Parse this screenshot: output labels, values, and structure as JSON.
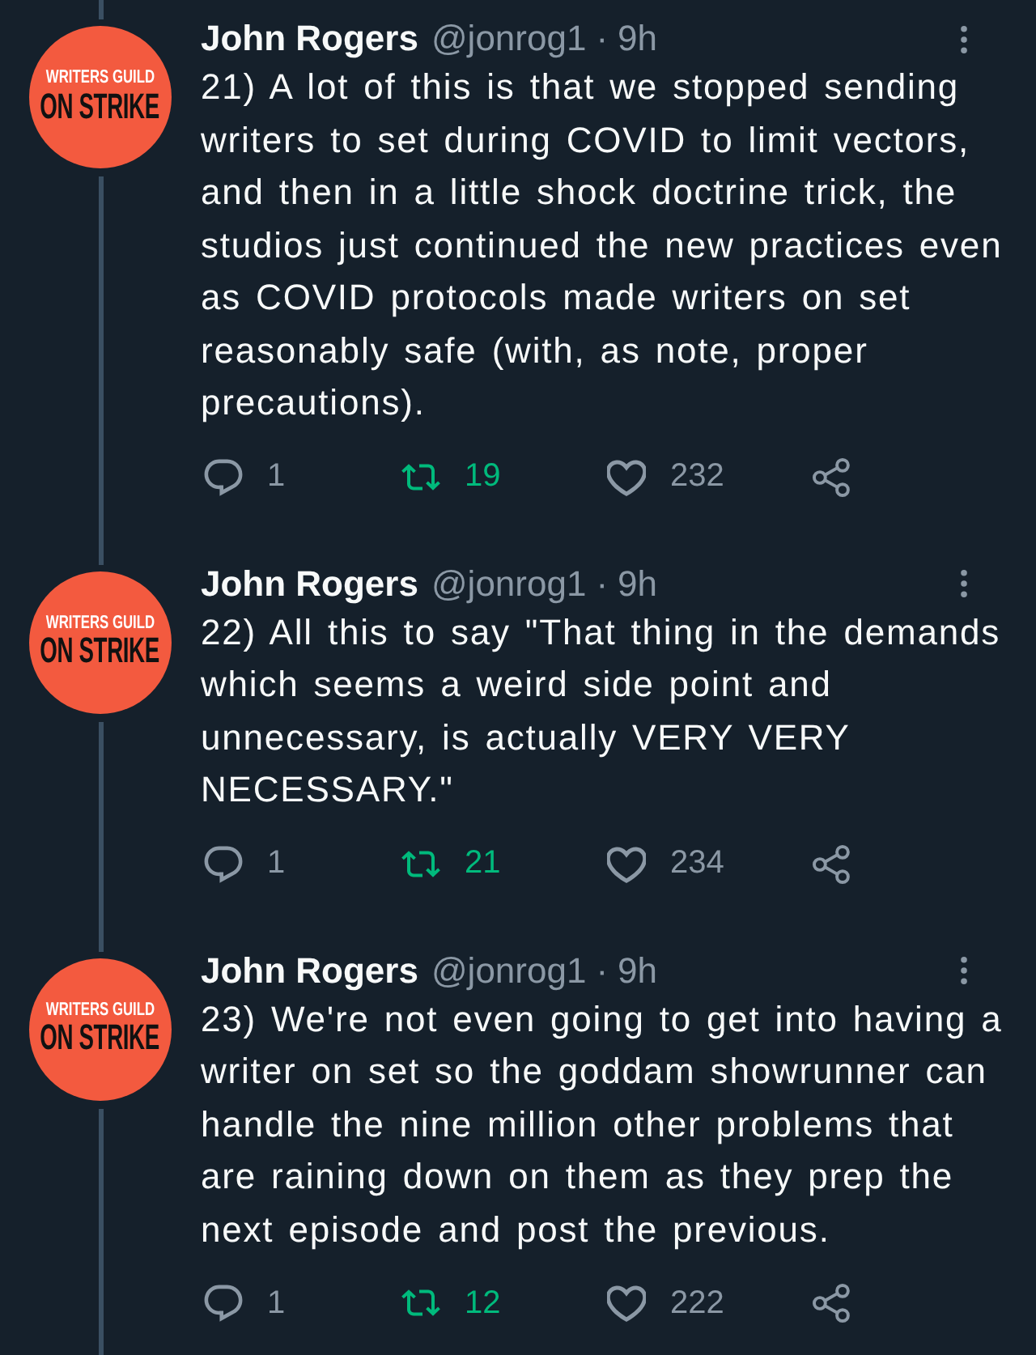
{
  "tweets": [
    {
      "avatar": {
        "line_1": "WRITERS GUILD",
        "line_2": "ON STRIKE"
      },
      "author": "John Rogers",
      "handle": "@jonrog1",
      "separator": "·",
      "time": "9h",
      "text": "21) A lot of this is that we stopped sending writers to set during COVID to limit vectors, and then in a little shock doctrine trick, the studios just continued the new practices even as COVID protocols made writers on set reasonably safe (with, as note, proper precautions).",
      "actions": {
        "replies": "1",
        "retweets": "19",
        "retweeted": true,
        "likes": "232",
        "liked": false
      }
    },
    {
      "avatar": {
        "line_1": "WRITERS GUILD",
        "line_2": "ON STRIKE"
      },
      "author": "John Rogers",
      "handle": "@jonrog1",
      "separator": "·",
      "time": "9h",
      "text": "22) All this to say \"That thing in the demands which seems a weird side point and unnecessary, is actually VERY VERY NECESSARY.\"",
      "actions": {
        "replies": "1",
        "retweets": "21",
        "retweeted": true,
        "likes": "234",
        "liked": false
      }
    },
    {
      "avatar": {
        "line_1": "WRITERS GUILD",
        "line_2": "ON STRIKE"
      },
      "author": "John Rogers",
      "handle": "@jonrog1",
      "separator": "·",
      "time": "9h",
      "text": "23) We're not even going to get into having a writer on set so the goddam showrunner can handle the nine million other problems that are raining down on them as they prep the next episode and post the previous.",
      "actions": {
        "replies": "1",
        "retweets": "12",
        "retweeted": true,
        "likes": "222",
        "liked": false
      }
    }
  ]
}
